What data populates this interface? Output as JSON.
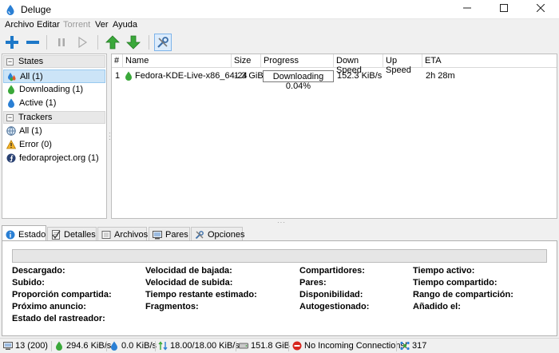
{
  "window": {
    "title": "Deluge"
  },
  "menubar": {
    "items": [
      "Archivo",
      "Editar",
      "Torrent",
      "Ver",
      "Ayuda"
    ]
  },
  "sidebar": {
    "states_header": "States",
    "states": [
      {
        "label": "All (1)",
        "icon": "all-states-icon"
      },
      {
        "label": "Downloading (1)",
        "icon": "downloading-icon"
      },
      {
        "label": "Active (1)",
        "icon": "active-icon"
      }
    ],
    "trackers_header": "Trackers",
    "trackers": [
      {
        "label": "All (1)",
        "icon": "globe-icon"
      },
      {
        "label": "Error (0)",
        "icon": "warning-icon"
      },
      {
        "label": "fedoraproject.org (1)",
        "icon": "fedora-icon"
      }
    ]
  },
  "torrent_list": {
    "columns": [
      "#",
      "Name",
      "Size",
      "Progress",
      "Down Speed",
      "Up Speed",
      "ETA"
    ],
    "rows": [
      {
        "index": "1",
        "name": "Fedora-KDE-Live-x86_64-24",
        "size": "1.3 GiB",
        "progress_text": "Downloading 0.04%",
        "progress": 0.0004,
        "down_speed": "152.3 KiB/s",
        "up_speed": "",
        "eta": "2h 28m"
      }
    ]
  },
  "tabs": [
    "Estado",
    "Detalles",
    "Archivos",
    "Pares",
    "Opciones"
  ],
  "status_panel": {
    "col1": [
      "Descargado:",
      "Subido:",
      "Proporción compartida:",
      "Próximo anuncio:",
      "Estado del rastreador:"
    ],
    "col2": [
      "Velocidad de bajada:",
      "Velocidad de subida:",
      "Tiempo restante estimado:",
      "Fragmentos:"
    ],
    "col3": [
      "Compartidores:",
      "Pares:",
      "Disponibilidad:",
      "Autogestionado:"
    ],
    "col4": [
      "Tiempo activo:",
      "Tiempo compartido:",
      "Rango de compartición:",
      "Añadido el:"
    ]
  },
  "statusbar": {
    "connections": "13 (200)",
    "down_speed": "294.6 KiB/s",
    "up_speed": "0.0 KiB/s",
    "protocol": "18.00/18.00 KiB/s",
    "disk_space": "151.8 GiB",
    "incoming": "No Incoming Connections!",
    "dht_nodes": "317"
  },
  "colors": {
    "accent_blue": "#1e78c8",
    "green": "#3aa83a",
    "progress_green": "#06b025",
    "selection": "#cce4f7"
  }
}
